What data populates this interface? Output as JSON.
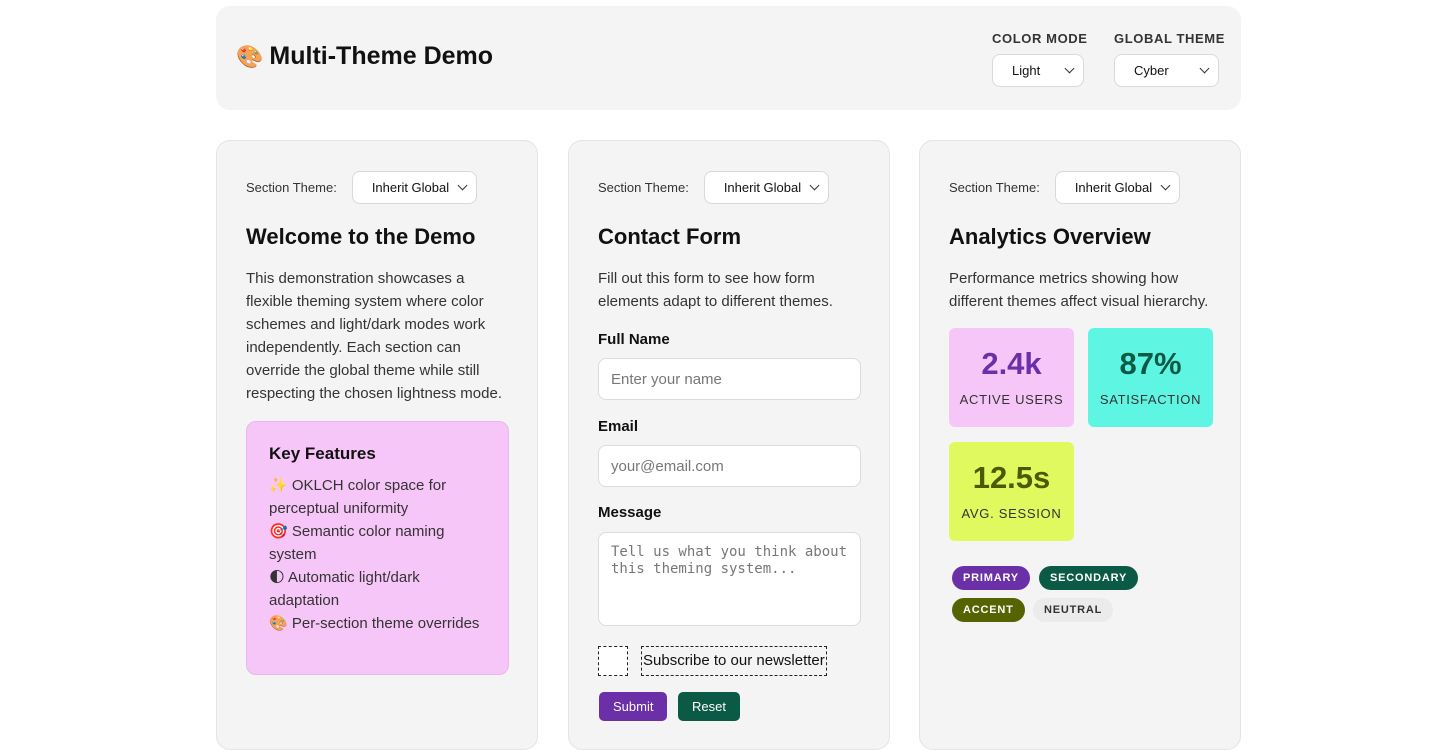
{
  "header": {
    "icon": "palette-icon",
    "icon_glyph": "🎨",
    "title": "Multi-Theme Demo",
    "color_mode": {
      "label": "COLOR MODE",
      "value": "Light"
    },
    "global_theme": {
      "label": "GLOBAL THEME",
      "value": "Cyber"
    }
  },
  "welcome": {
    "section_label": "Section Theme:",
    "section_value": "Inherit Global",
    "title": "Welcome to the Demo",
    "description": "This demonstration showcases a flexible theming system where color schemes and light/dark modes work independently. Each section can override the global theme while still respecting the chosen lightness mode.",
    "features_title": "Key Features",
    "features": [
      "✨ OKLCH color space for perceptual uniformity",
      "🎯 Semantic color naming system",
      "🌓 Automatic light/dark adaptation",
      "🎨 Per-section theme overrides"
    ],
    "features_color": "#f7c6f9"
  },
  "contact": {
    "section_label": "Section Theme:",
    "section_value": "Inherit Global",
    "title": "Contact Form",
    "description": "Fill out this form to see how form elements adapt to different themes.",
    "name_label": "Full Name",
    "name_placeholder": "Enter your name",
    "email_label": "Email",
    "email_placeholder": "your@email.com",
    "message_label": "Message",
    "message_placeholder": "Tell us what you think about this theming system...",
    "newsletter_label": "Subscribe to our newsletter",
    "submit_label": "Submit",
    "reset_label": "Reset",
    "submit_color": "#6b2fa8",
    "reset_color": "#0b5a45"
  },
  "analytics": {
    "section_label": "Section Theme:",
    "section_value": "Inherit Global",
    "title": "Analytics Overview",
    "description": "Performance metrics showing how different themes affect visual hierarchy.",
    "stats": [
      {
        "value": "2.4k",
        "label": "ACTIVE USERS",
        "bg": "#f7c6f9",
        "color": "#6b2fa8"
      },
      {
        "value": "87%",
        "label": "SATISFACTION",
        "bg": "#5ff5e3",
        "color": "#0b5a45"
      },
      {
        "value": "12.5s",
        "label": "AVG. SESSION",
        "bg": "#e0f95f",
        "color": "#4a5a00"
      }
    ],
    "badges": [
      {
        "label": "PRIMARY",
        "bg": "#6b2fa8",
        "color": "#ffffff"
      },
      {
        "label": "SECONDARY",
        "bg": "#0b5a45",
        "color": "#ffffff"
      },
      {
        "label": "ACCENT",
        "bg": "#556300",
        "color": "#ffffff"
      },
      {
        "label": "NEUTRAL",
        "bg": "#ebebeb",
        "color": "#333333"
      }
    ]
  }
}
